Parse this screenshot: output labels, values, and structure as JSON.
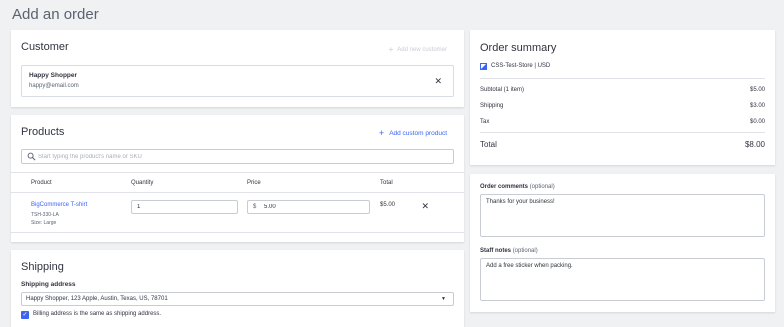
{
  "page": {
    "title": "Add an order"
  },
  "customer": {
    "title": "Customer",
    "add_new_label": "Add new customer",
    "name": "Happy Shopper",
    "email": "happy@email.com"
  },
  "products": {
    "title": "Products",
    "add_custom_label": "Add custom product",
    "search_placeholder": "Start typing the product's name or SKU",
    "columns": [
      "Product",
      "Quantity",
      "Price",
      "Total"
    ],
    "rows": [
      {
        "name": "BigCommerce T-shirt",
        "sku": "TSH-330-LA",
        "size": "Size: Large",
        "quantity": "1",
        "currency_symbol": "$",
        "price": "5.00",
        "total": "$5.00"
      }
    ]
  },
  "shipping": {
    "title": "Shipping",
    "address_label": "Shipping address",
    "address_value": "Happy Shopper, 123 Apple, Austin, Texas, US, 78701",
    "billing_same_label": "Billing address is the same as shipping address.",
    "billing_same_checked": true
  },
  "summary": {
    "title": "Order summary",
    "store": "CSS-Test-Store | USD",
    "subtotal_label": "Subtotal (1 item)",
    "subtotal": "$5.00",
    "shipping_label": "Shipping",
    "shipping": "$3.00",
    "tax_label": "Tax",
    "tax": "$0.00",
    "total_label": "Total",
    "total": "$8.00"
  },
  "notes": {
    "comments_label": "Order comments",
    "comments_optional": "(optional)",
    "comments_value": "Thanks for your business!",
    "staff_label": "Staff notes",
    "staff_optional": "(optional)",
    "staff_value": "Add a free sticker when packing."
  },
  "colors": {
    "accent": "#3c64f4",
    "background": "#f0f1f3",
    "text": "#313440"
  }
}
